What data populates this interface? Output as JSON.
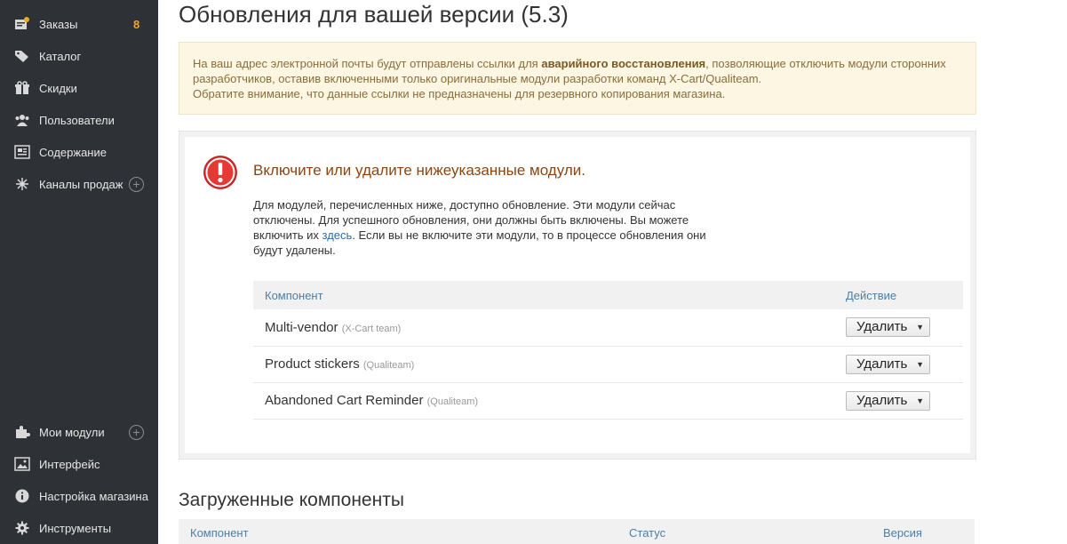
{
  "sidebar": {
    "top_items": [
      {
        "label": "Заказы",
        "icon": "orders-icon",
        "count": "8"
      },
      {
        "label": "Каталог",
        "icon": "tag-icon"
      },
      {
        "label": "Скидки",
        "icon": "gift-icon"
      },
      {
        "label": "Пользователи",
        "icon": "users-icon"
      },
      {
        "label": "Содержание",
        "icon": "content-icon"
      },
      {
        "label": "Каналы продаж",
        "icon": "channels-icon"
      }
    ],
    "bottom_items": [
      {
        "label": "Мои модули",
        "icon": "puzzle-icon"
      },
      {
        "label": "Интерфейс",
        "icon": "image-icon"
      },
      {
        "label": "Настройка магазина",
        "icon": "info-icon"
      },
      {
        "label": "Инструменты",
        "icon": "gear-icon"
      }
    ]
  },
  "page": {
    "title": "Обновления для вашей версии (5.3)"
  },
  "alert": {
    "text_1": "На ваш адрес электронной почты будут отправлены ссылки для ",
    "bold": "аварийного восстановления",
    "text_2": ", позволяющие отключить модули сторонних разработчиков, оставив включенными только оригинальные модули разработки команд X-Cart/Qualiteam.",
    "text_3": "Обратите внимание, что данные ссылки не предназначены для резервного копирования магазина."
  },
  "warning": {
    "title": "Включите или удалите нижеуказанные модули.",
    "text_1": "Для модулей, перечисленных ниже, доступно обновление. Эти модули сейчас отключены. Для успешного обновления, они должны быть включены. Вы можете включить их ",
    "link": "здесь",
    "text_2": ". Если вы не включите эти модули, то в процессе обновления они будут удалены."
  },
  "modules_table": {
    "col_component": "Компонент",
    "col_action": "Действие",
    "rows": [
      {
        "name": "Multi-vendor",
        "vendor": "(X-Cart team)",
        "action": "Удалить"
      },
      {
        "name": "Product stickers",
        "vendor": "(Qualiteam)",
        "action": "Удалить"
      },
      {
        "name": "Abandoned Cart Reminder",
        "vendor": "(Qualiteam)",
        "action": "Удалить"
      }
    ]
  },
  "downloaded": {
    "title": "Загруженные компоненты",
    "col_component": "Компонент",
    "col_status": "Статус",
    "col_version": "Версия"
  },
  "colors": {
    "sidebar_bg": "#2e3236",
    "badge": "#f5a623",
    "alert_bg": "#fdf6e3",
    "warning_title": "#8b4513",
    "header_text": "#4a7fa8"
  }
}
